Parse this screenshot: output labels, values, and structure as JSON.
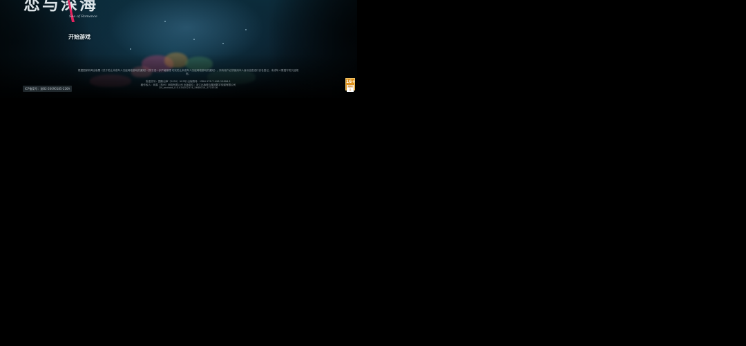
{
  "game": {
    "logo_title": "恋与深海",
    "logo_subtitle": "Sea of Romance",
    "start_label": "开始游戏"
  },
  "footer": {
    "notice": "根据国家新闻出版署《关于防止未成年人沉迷网络游戏的通知》《关于进一步严格管理 切实防止未成年人沉迷网络游戏的通知》，所有用户必须使用本人身份信息进行实名登记，未成年人需遵守防沉迷规则。",
    "publish_line_1": "批准文号：国新出审〔2020〕993号        出版物号：ISBN 978-7-498-15806-1",
    "publish_line_2": "著作权人：网易（杭州）网络有限公司   出版单位：浙江出版联合集团数字传媒有限公司",
    "version": "CN_android_0.0.434202374_5648014_5715516",
    "icp": "ICP备案号：浙B2-20090185-226A"
  },
  "age_rating": {
    "age": "16+",
    "label": "适龄提示"
  },
  "colors": {
    "background": "#000000",
    "scene_dark": "#06141c",
    "scene_light": "#0c2c3b",
    "logo_accent": "#e0245e",
    "age_badge": "#e0931e"
  }
}
